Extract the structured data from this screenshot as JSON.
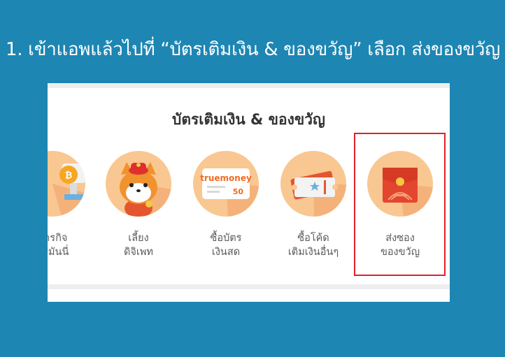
{
  "instruction": "1. เข้าแอพแล้วไปที่ “บัตรเติมเงิน & ของขวัญ” เลือก ส่งของขวัญ",
  "panel": {
    "title": "บัตรเติมเงิน & ของขวัญ",
    "items": [
      {
        "line1": "ภารกิจ",
        "line2": "ทรูมันนี่",
        "icon": "trophy-icon"
      },
      {
        "line1": "เลี้ยง",
        "line2": "ดิจิเพท",
        "icon": "shiba-pet-icon"
      },
      {
        "line1": "ซื้อบัตร",
        "line2": "เงินสด",
        "icon": "truemoney-card-icon",
        "card_brand": "truemoney",
        "card_value": "50"
      },
      {
        "line1": "ซื้อโค้ด",
        "line2": "เติมเงินอื่นๆ",
        "icon": "ticket-code-icon"
      },
      {
        "line1": "ส่งซอง",
        "line2": "ของขวัญ",
        "icon": "red-envelope-icon"
      }
    ]
  },
  "colors": {
    "background": "#1d86b3",
    "icon_circle": "#f9c791",
    "highlight_border": "#e0212b",
    "brand_orange": "#f26b21"
  }
}
